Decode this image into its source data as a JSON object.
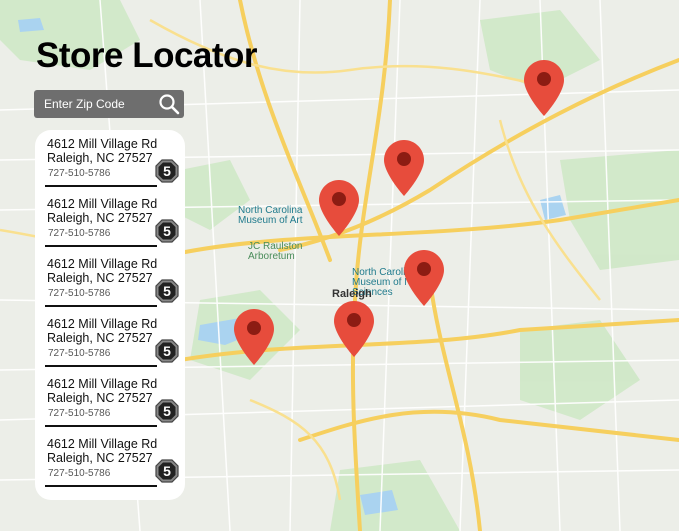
{
  "title": "Store Locator",
  "search": {
    "placeholder": "Enter Zip Code",
    "icon": "search-icon"
  },
  "stores": [
    {
      "address_line1": "4612 Mill Village Rd",
      "address_line2": "Raleigh, NC 27527",
      "phone": "727-510-5786",
      "badge": "5"
    },
    {
      "address_line1": "4612 Mill Village Rd",
      "address_line2": "Raleigh, NC 27527",
      "phone": "727-510-5786",
      "badge": "5"
    },
    {
      "address_line1": "4612 Mill Village Rd",
      "address_line2": "Raleigh, NC 27527",
      "phone": "727-510-5786",
      "badge": "5"
    },
    {
      "address_line1": "4612 Mill Village Rd",
      "address_line2": "Raleigh, NC 27527",
      "phone": "727-510-5786",
      "badge": "5"
    },
    {
      "address_line1": "4612 Mill Village Rd",
      "address_line2": "Raleigh, NC 27527",
      "phone": "727-510-5786",
      "badge": "5"
    },
    {
      "address_line1": "4612 Mill Village Rd",
      "address_line2": "Raleigh, NC 27527",
      "phone": "727-510-5786",
      "badge": "5"
    }
  ],
  "map": {
    "city_label": "Raleigh",
    "poi_labels": {
      "museum": "North Carolina Museum of Art",
      "arboretum": "JC Raulston Arboretum",
      "science": "North Carolina Museum of Natural Sciences"
    },
    "pin_color": "#e74c3c",
    "road_color": "#f6cf5e"
  }
}
